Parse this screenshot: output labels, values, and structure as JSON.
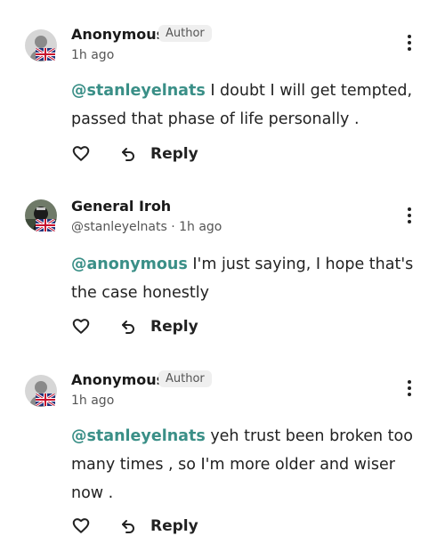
{
  "comments": [
    {
      "name": "Anonymous",
      "badge": "Author",
      "time": "1h ago",
      "mention": "@stanleyelnats",
      "text": " I doubt I will get tempted, passed that phase of life personally .",
      "reply_label": "Reply",
      "avatar": "anonymous-avatar",
      "flag": "uk-flag"
    },
    {
      "name": "General Iroh",
      "meta": "@stanleyelnats · 1h ago",
      "mention": "@anonymous",
      "text": " I'm just saying, I hope that's the case honestly",
      "reply_label": "Reply",
      "avatar": "general-iroh-avatar",
      "flag": "uk-flag"
    },
    {
      "name": "Anonymous",
      "badge": "Author",
      "time": "1h ago",
      "mention": "@stanleyelnats",
      "text": " yeh trust been broken too many times , so I'm more older and wiser now .",
      "reply_label": "Reply",
      "avatar": "anonymous-avatar",
      "flag": "uk-flag"
    }
  ],
  "colors": {
    "mention": "#3a8f87",
    "badge_bg": "#efefef"
  }
}
